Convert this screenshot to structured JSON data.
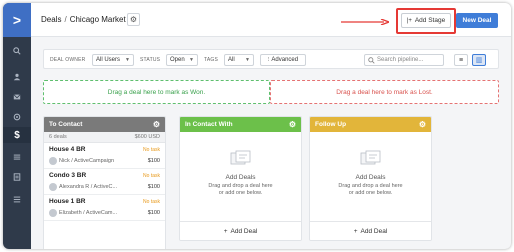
{
  "nav": {
    "logo": ">",
    "items": [
      "search-icon",
      "contacts-icon",
      "email-icon",
      "automations-icon",
      "deals-icon",
      "lists-icon",
      "reports-icon",
      "settings-icon"
    ]
  },
  "header": {
    "section": "Deals",
    "separator": "/",
    "pipeline": "Chicago Market",
    "add_stage": "Add Stage",
    "new_deal": "New Deal"
  },
  "filters": {
    "owner_label": "DEAL OWNER",
    "owner_value": "All Users",
    "status_label": "STATUS",
    "status_value": "Open",
    "tags_label": "TAGS",
    "tags_value": "All",
    "advanced": "Advanced",
    "search_placeholder": "Search pipeline..."
  },
  "dropzones": {
    "won": "Drag a deal here to mark as Won.",
    "lost": "Drag a deal here to mark as Lost."
  },
  "stages": [
    {
      "name": "To Contact",
      "color": "#7a7a7a",
      "count": "6 deals",
      "total": "$600 USD",
      "deals": [
        {
          "title": "House 4 BR",
          "owner": "Nick / ActiveCampaign",
          "value": "$100",
          "task": "No task"
        },
        {
          "title": "Condo 3 BR",
          "owner": "Alexandra R / ActiveC...",
          "value": "$100",
          "task": "No task"
        },
        {
          "title": "House 1 BR",
          "owner": "Elizabeth / ActiveCam...",
          "value": "$100",
          "task": "No task"
        }
      ]
    },
    {
      "name": "In Contact With",
      "color": "#6cc04a",
      "empty_title": "Add Deals",
      "empty_line1": "Drag and drop a deal here",
      "empty_line2": "or add one below.",
      "add_deal": "Add Deal"
    },
    {
      "name": "Follow Up",
      "color": "#e2b53a",
      "empty_title": "Add Deals",
      "empty_line1": "Drag and drop a deal here",
      "empty_line2": "or add one below.",
      "add_deal": "Add Deal"
    }
  ],
  "colors": {
    "nav_bg": "#2f3a4a",
    "accent": "#3f7dd8",
    "highlight": "#e53935"
  }
}
